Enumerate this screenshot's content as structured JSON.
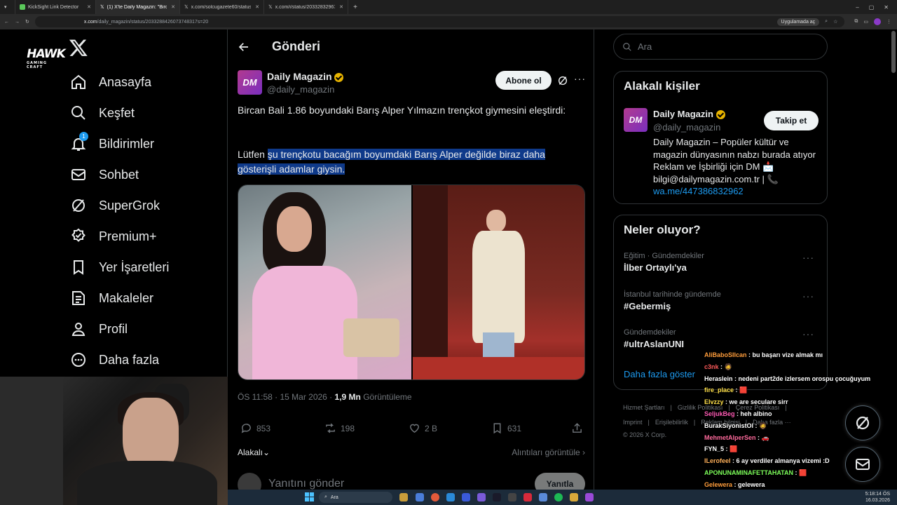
{
  "browser": {
    "tabs": [
      {
        "label": "KickSight Link Detector",
        "active": false
      },
      {
        "label": "(1) X'te Daily Magazin: \"Bircan",
        "active": true
      },
      {
        "label": "x.com/solcugazete60/status/20",
        "active": false
      },
      {
        "label": "x.com/i/status/20332832967",
        "active": false
      }
    ],
    "url_host": "x.com",
    "url_path": "/daily_magazin/status/2033288426073748317s=20",
    "app_button": "Uygulamada aç"
  },
  "overlay_logo": {
    "line1": "HAWK",
    "line2": "GAMING CRAFT"
  },
  "nav": {
    "items": [
      {
        "label": "Anasayfa",
        "icon": "home-icon"
      },
      {
        "label": "Keşfet",
        "icon": "search-icon"
      },
      {
        "label": "Bildirimler",
        "icon": "bell-icon",
        "badge": "1"
      },
      {
        "label": "Sohbet",
        "icon": "mail-icon"
      },
      {
        "label": "SuperGrok",
        "icon": "grok-icon"
      },
      {
        "label": "Premium+",
        "icon": "premium-icon"
      },
      {
        "label": "Yer İşaretleri",
        "icon": "bookmark-icon"
      },
      {
        "label": "Makaleler",
        "icon": "article-icon"
      },
      {
        "label": "Profil",
        "icon": "profile-icon"
      },
      {
        "label": "Daha fazla",
        "icon": "more-icon"
      }
    ]
  },
  "post": {
    "header_title": "Gönderi",
    "author_name": "Daily Magazin",
    "author_handle": "@daily_magazin",
    "avatar_text": "DM",
    "subscribe_label": "Abone ol",
    "text_line1": "Bircan Bali 1.86 boyundaki Barış Alper Yılmazın trençkot giymesini eleştirdi:",
    "text_quote_prefix": "Lütfen ",
    "text_quote_highlight": "şu trençkotu bacağım boyumdaki Barış Alper değilde biraz daha gösterişli adamlar giysin.",
    "time": "ÖS 11:58 · 15 Mar 2026 · ",
    "views_count": "1,9 Mn",
    "views_label": "Görüntüleme",
    "replies": "853",
    "reposts": "198",
    "likes": "2 B",
    "bookmarks": "631",
    "sort_label": "Alakalı",
    "quotes_label": "Alıntıları görüntüle",
    "reply_placeholder": "Yanıtını gönder",
    "reply_button": "Yanıtla"
  },
  "right": {
    "search_placeholder": "Ara",
    "related_title": "Alakalı kişiler",
    "related_name": "Daily Magazin",
    "related_handle": "@daily_magazin",
    "follow_label": "Takip et",
    "related_bio": "Daily Magazin – Popüler kültür ve magazin dünyasının nabzı burada atıyor Reklam ve İşbirliği için DM 📩 bilgi@dailymagazin.com.tr | 📞",
    "related_link": "wa.me/447386832962",
    "trends_title": "Neler oluyor?",
    "trends": [
      {
        "category": "Eğitim · Gündemdekiler",
        "name": "İlber Ortaylı'ya"
      },
      {
        "category": "İstanbul tarihinde gündemde",
        "name": "#Gebermiş"
      },
      {
        "category": "Gündemdekiler",
        "name": "#ultrAslanUNI"
      }
    ],
    "show_more": "Daha fazla göster",
    "footer_row1": [
      "Hizmet Şartları",
      "Gizlilik Politikası",
      "Çerez Politikası"
    ],
    "footer_row2": [
      "Imprint",
      "Erişilebilirlik",
      "Reklam bilgisi",
      "Daha fazla ···"
    ],
    "copyright": "© 2026 X Corp."
  },
  "chat": [
    {
      "user": "AliBaboSIlcan",
      "text": ": bu başarı vize almak mı",
      "color": "#ff9d3b"
    },
    {
      "user": "c3nk",
      "text": ": 🧔",
      "color": "#ff5a5a"
    },
    {
      "user": "Heraslein",
      "text": ": nedeni part2de izlersem orospu çocuğuyum",
      "color": "#ffffff"
    },
    {
      "user": "fire_place",
      "text": ": 🟥",
      "color": "#ffe04a"
    },
    {
      "user": "Elvzzy",
      "text": ": we are seculare sirr",
      "color": "#ffe04a"
    },
    {
      "user": "SeljukBeg",
      "text": ": heh albino",
      "color": "#ff5ab4"
    },
    {
      "user": "BurakSiyonistOl",
      "text": ": 🧔",
      "color": "#ffffff"
    },
    {
      "user": "MehmetAlperSen",
      "text": ": 🚗",
      "color": "#ff6a9c"
    },
    {
      "user": "FYN_5",
      "text": ": 🟥",
      "color": "#ffffff"
    },
    {
      "user": "ILerofeel",
      "text": ": 6 ay verdiler almanya vizemi :D",
      "color": "#ffb15a"
    },
    {
      "user": "APONUNAMINAFETTAHATAN",
      "text": ": 🟥",
      "color": "#7dff5a"
    },
    {
      "user": "Gelewera",
      "text": ": gelewera",
      "color": "#ff9d3b"
    }
  ],
  "taskbar": {
    "search": "Ara",
    "time": "5:18:14 ÖS",
    "date": "16.03.2026"
  },
  "colors": {
    "accent": "#1d9bf0",
    "verified": "#e8b400",
    "highlight": "#0f3a8a"
  }
}
